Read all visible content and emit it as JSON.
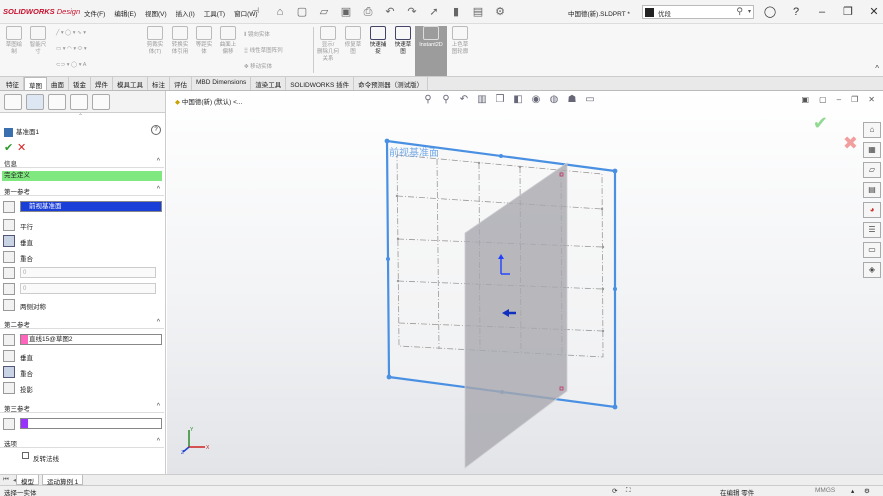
{
  "app": {
    "logo": "SOLIDWORKS",
    "logo_sub": "Design",
    "menus": [
      "文件(F)",
      "编辑(E)",
      "视图(V)",
      "插入(I)",
      "工具(T)",
      "窗口(W)"
    ],
    "doc_title": "中国德(新).SLDPRT *",
    "search_text": "优段"
  },
  "ribbon": {
    "buttons": [
      {
        "label1": "草图绘",
        "label2": "制",
        "state": "disabled"
      },
      {
        "label1": "智能尺",
        "label2": "寸",
        "state": "disabled"
      },
      {
        "label1": "剪裁实",
        "label2": "体(T)",
        "state": "disabled"
      },
      {
        "label1": "转换实",
        "label2": "体引用",
        "state": "disabled"
      },
      {
        "label1": "等距实",
        "label2": "体",
        "state": "disabled"
      },
      {
        "label1": "曲面上",
        "label2": "偏移",
        "state": "disabled"
      },
      {
        "label1": "显示/",
        "label2": "删除几何关系",
        "state": "disabled"
      },
      {
        "label1": "修复草",
        "label2": "图",
        "state": "disabled"
      },
      {
        "label1": "快速捕",
        "label2": "捉",
        "state": "active"
      },
      {
        "label1": "快速草",
        "label2": "图",
        "state": "active"
      },
      {
        "label1": "Instant2D",
        "label2": "",
        "state": "selected"
      },
      {
        "label1": "上色草",
        "label2": "图轮廓",
        "state": "disabled"
      }
    ],
    "small": [
      "镜向实体",
      "线性草图阵列",
      "移动实体"
    ]
  },
  "tabs": [
    "特征",
    "草图",
    "曲面",
    "钣金",
    "焊件",
    "模具工具",
    "标注",
    "评估",
    "MBD Dimensions",
    "渲染工具",
    "SOLIDWORKS 插件",
    "命令预测器（测试版）"
  ],
  "active_tab": "草图",
  "panel": {
    "title": "基准面1",
    "msg_header": "信息",
    "status": "完全定义",
    "ref1": {
      "header": "第一参考",
      "selection": "前视基准面",
      "options": [
        "平行",
        "垂直",
        "重合"
      ],
      "angle": "0",
      "distance": "0",
      "symmetric": "两侧对称"
    },
    "ref2": {
      "header": "第二参考",
      "selection": "直线15@草图2",
      "swatch": "#ff66bb",
      "options": [
        "垂直",
        "重合",
        "投影"
      ]
    },
    "ref3": {
      "header": "第三参考",
      "swatch": "#9933ff"
    },
    "options": {
      "header": "选项",
      "flip_normal": "反转法线"
    }
  },
  "graphics": {
    "breadcrumb": "中国德(新) (默认) <...",
    "plane_label": "前视基准面",
    "triad": {
      "x": "X",
      "y": "Y",
      "z": "Z"
    }
  },
  "bottom_tabs": [
    "模型",
    "运动算例 1"
  ],
  "status": {
    "left": "选择一实体",
    "mode": "在编辑 零件",
    "units": "MMGS"
  }
}
